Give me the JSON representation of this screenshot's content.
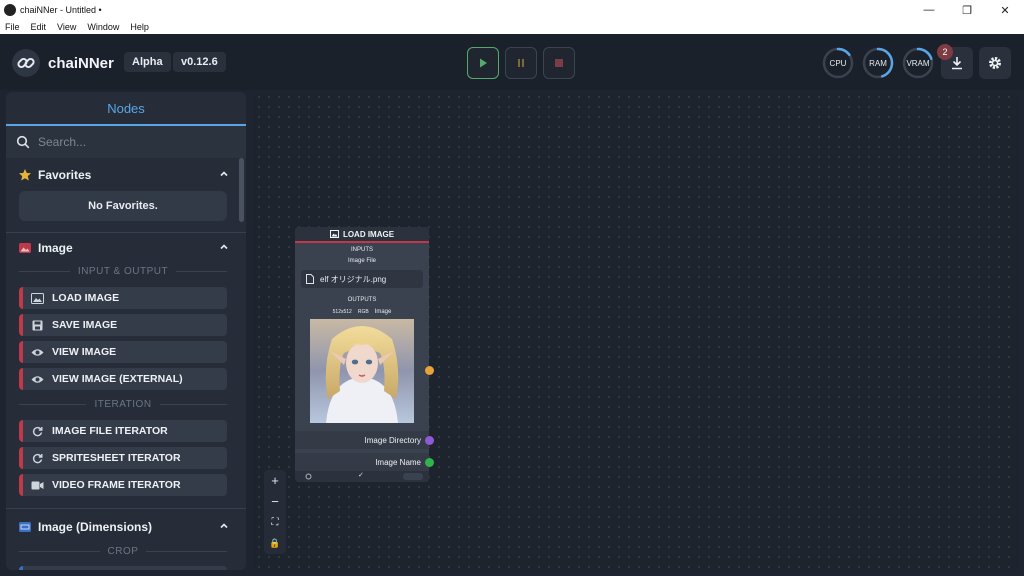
{
  "window": {
    "title": "chaiNNer - Untitled •",
    "controls": {
      "minimize": "—",
      "maximize": "❐",
      "close": "✕"
    }
  },
  "menubar": [
    "File",
    "Edit",
    "View",
    "Window",
    "Help"
  ],
  "header": {
    "brand": "chaiNNer",
    "channel": "Alpha",
    "version": "v0.12.6",
    "gauges": [
      {
        "label": "CPU",
        "level": 0.15,
        "color": "#5aa5e6"
      },
      {
        "label": "RAM",
        "level": 0.45,
        "color": "#5aa5e6"
      },
      {
        "label": "VRAM",
        "level": 0.2,
        "color": "#5aa5e6"
      }
    ],
    "download_badge": "2",
    "colors": {
      "play": "#57a86b",
      "accent": "#5aa5e6"
    }
  },
  "sidebar": {
    "tab": "Nodes",
    "search_placeholder": "Search...",
    "favorites": {
      "title": "Favorites",
      "empty": "No Favorites."
    },
    "categories": [
      {
        "title": "Image",
        "sections": [
          {
            "label": "INPUT & OUTPUT",
            "items": [
              "LOAD IMAGE",
              "SAVE IMAGE",
              "VIEW IMAGE",
              "VIEW IMAGE (EXTERNAL)"
            ]
          },
          {
            "label": "ITERATION",
            "items": [
              "IMAGE FILE ITERATOR",
              "SPRITESHEET ITERATOR",
              "VIDEO FRAME ITERATOR"
            ]
          }
        ]
      },
      {
        "title": "Image (Dimensions)",
        "sections": [
          {
            "label": "CROP",
            "items": []
          }
        ]
      }
    ],
    "colors": {
      "image_category": "#c0394b",
      "dimensions_category": "#3b6fc4"
    }
  },
  "node": {
    "title": "LOAD IMAGE",
    "inputs_label": "INPUTS",
    "input_name": "Image File",
    "file_value": "elf オリジナル.png",
    "outputs_label": "OUTPUTS",
    "output_meta": {
      "size": "512x512",
      "mode": "RGB",
      "name": "Image"
    },
    "outputs": [
      {
        "label": "Image Directory",
        "color": "#8e5bd6"
      },
      {
        "label": "Image Name",
        "color": "#2fb54b"
      }
    ],
    "image_handle_color": "#e8a33a",
    "footer_check": "✓"
  },
  "canvas_controls": [
    "+",
    "−",
    "⛶",
    "🔒"
  ]
}
